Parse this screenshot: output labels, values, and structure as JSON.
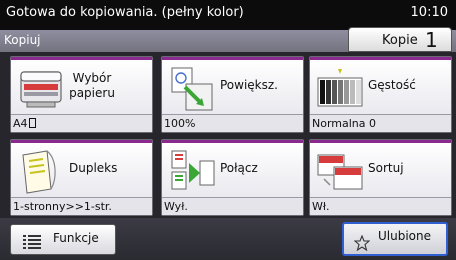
{
  "status": {
    "message": "Gotowa do kopiowania. (pełny kolor)",
    "time": "10:10"
  },
  "header": {
    "title": "Kopiuj",
    "copies_label": "Kopie",
    "copies_count": "1"
  },
  "tiles": [
    {
      "label_line1": "Wybór",
      "label_line2": "papieru",
      "value": "A4",
      "icon": "paper-tray-icon"
    },
    {
      "label": "Powiększ.",
      "value": "100%",
      "icon": "zoom-icon"
    },
    {
      "label": "Gęstość",
      "value": "Normalna 0",
      "icon": "density-icon"
    },
    {
      "label": "Dupleks",
      "value": "1-stronny>>1-str.",
      "icon": "duplex-icon"
    },
    {
      "label": "Połącz",
      "value": "Wył.",
      "icon": "combine-icon"
    },
    {
      "label": "Sortuj",
      "value": "Wł.",
      "icon": "collate-icon"
    }
  ],
  "footer": {
    "functions_label": "Funkcje",
    "favorites_label": "Ulubione"
  },
  "colors": {
    "accent_purple": "#8b2a8e",
    "favorites_border": "#2f5fd0"
  }
}
